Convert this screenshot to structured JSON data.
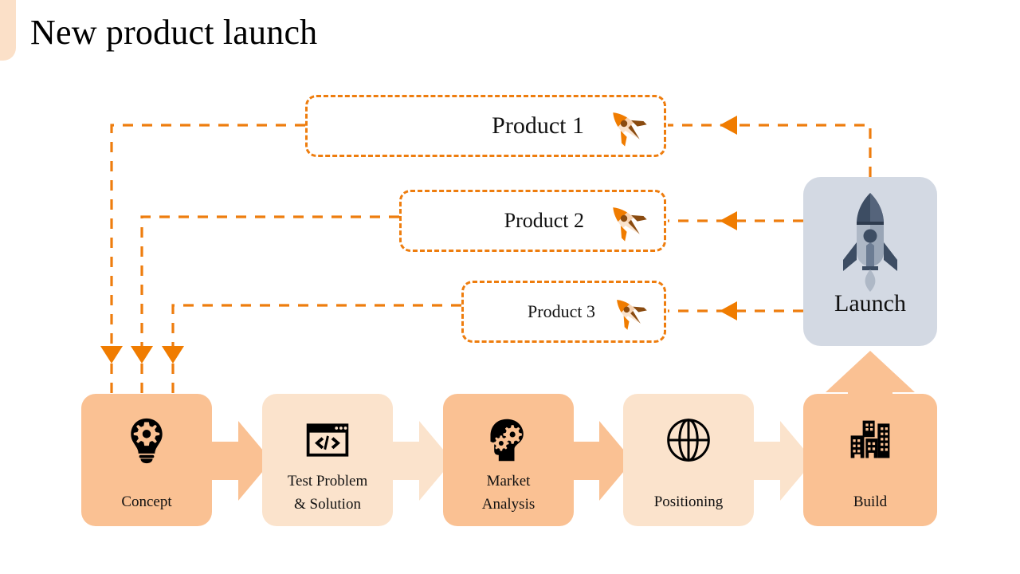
{
  "page": {
    "title": "New product launch",
    "background_color": "#ffffff"
  },
  "colors": {
    "accent_orange": "#EE7D0E",
    "step_dark": "#FAC193",
    "step_light": "#FBE3CC",
    "arrow_dark": "#FAC193",
    "arrow_light": "#FBE3CC",
    "launch_panel": "#D3D9E3",
    "title_bar": "#FBE0C8",
    "icon_black": "#000000",
    "rocket_dark": "#3D4D63",
    "rocket_light": "#AEB8C6"
  },
  "products": [
    {
      "label": "Product 1",
      "icon": "rocket-emoji"
    },
    {
      "label": "Product 2",
      "icon": "rocket-emoji"
    },
    {
      "label": "Product 3",
      "icon": "rocket-emoji"
    }
  ],
  "launch": {
    "label": "Launch",
    "icon": "rocket-icon"
  },
  "process_steps": [
    {
      "label": "Concept",
      "label_line1": "Concept",
      "label_line2": "",
      "icon": "lightbulb-gear-icon",
      "shade": "dark"
    },
    {
      "label": "Test Problem & Solution",
      "label_line1": "Test Problem",
      "label_line2": "& Solution",
      "icon": "code-window-icon",
      "shade": "light"
    },
    {
      "label": "Market Analysis",
      "label_line1": "Market",
      "label_line2": "Analysis",
      "icon": "head-gears-icon",
      "shade": "dark"
    },
    {
      "label": "Positioning",
      "label_line1": "Positioning",
      "label_line2": "",
      "icon": "globe-icon",
      "shade": "light"
    },
    {
      "label": "Build",
      "label_line1": "Build",
      "label_line2": "",
      "icon": "buildings-icon",
      "shade": "dark"
    }
  ],
  "connectors": {
    "launch_to_products": [
      {
        "from": "launch",
        "to": "Product 1",
        "arrow": "triangle-left"
      },
      {
        "from": "launch",
        "to": "Product 2",
        "arrow": "triangle-left"
      },
      {
        "from": "launch",
        "to": "Product 3",
        "arrow": "triangle-left"
      }
    ],
    "products_to_concept": [
      {
        "from": "Product 1",
        "to": "Concept",
        "arrow": "triangle-down"
      },
      {
        "from": "Product 2",
        "to": "Concept",
        "arrow": "triangle-down"
      },
      {
        "from": "Product 3",
        "to": "Concept",
        "arrow": "triangle-down"
      }
    ],
    "build_to_launch": {
      "from": "Build",
      "to": "Launch",
      "arrow": "arrow-up"
    }
  }
}
